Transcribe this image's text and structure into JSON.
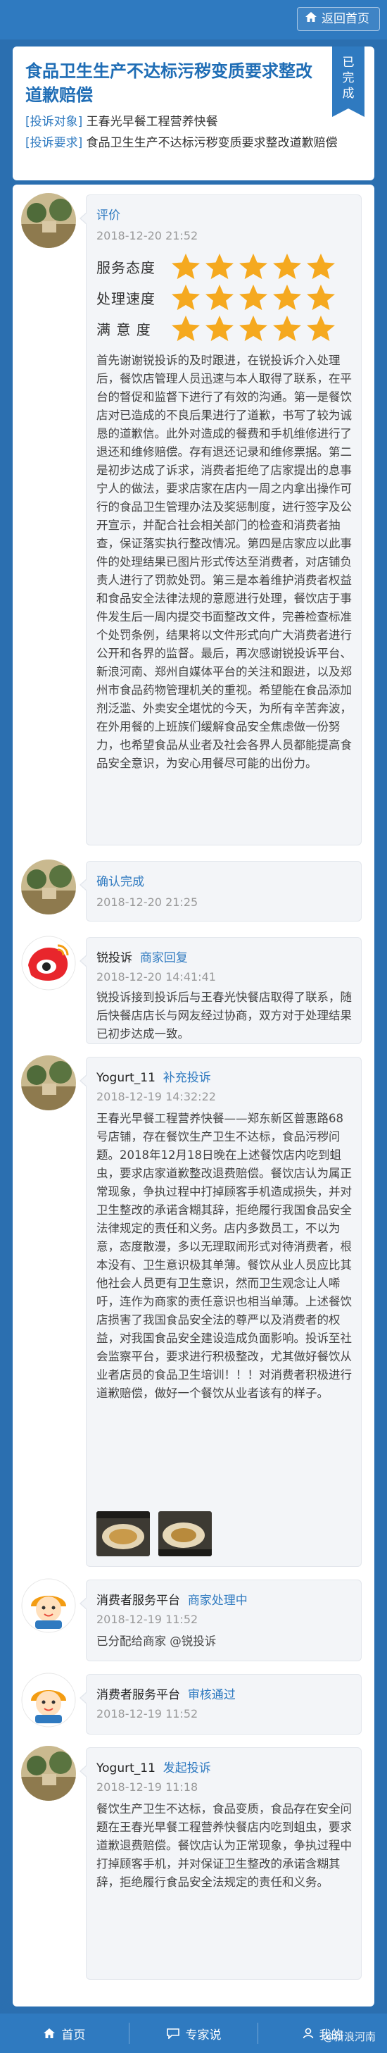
{
  "header": {
    "back_label": "返回首页"
  },
  "complaint": {
    "title": "食品卫生生产不达标污秽变质要求整改道歉赔偿",
    "status": "已完成",
    "target_tag": "[投诉对象]",
    "target_value": "王春光早餐工程营养快餐",
    "demand_tag": "[投诉要求]",
    "demand_value": "食品卫生生产不达标污秽变质要求整改道歉赔偿"
  },
  "thread": [
    {
      "kind": "review",
      "head": "评价",
      "time": "2018-12-20 21:52",
      "ratings": [
        {
          "label": "服务态度",
          "stars": 5
        },
        {
          "label": "处理速度",
          "stars": 5
        },
        {
          "label": "满 意 度",
          "stars": 5
        }
      ],
      "text": "首先谢谢锐投诉的及时跟进，在锐投诉介入处理后，餐饮店管理人员迅速与本人取得了联系，在平台的督促和监督下进行了有效的沟通。第一是餐饮店对已造成的不良后果进行了道歉，书写了较为诚恳的道歉信。此外对造成的餐费和手机维修进行了退还和维修赔偿。存有退还记录和维修票据。第二是初步达成了诉求，消费者拒绝了店家提出的息事宁人的做法，要求店家在店内一周之内拿出操作可行的食品卫生管理办法及奖惩制度，进行签字及公开宣示，并配合社会相关部门的检查和消费者抽查，保证落实执行整改情况。第四是店家应以此事件的处理结果已图片形式传达至消费者，对店铺负责人进行了罚款处罚。第三是本着维护消费者权益和食品安全法律法规的意愿进行处理，餐饮店于事件发生后一周内提交书面整改文件，完善检查标准个处罚条例，结果将以文件形式向广大消费者进行公开和各界的监督。最后，再次感谢锐投诉平台、新浪河南、郑州自媒体平台的关注和跟进，以及郑州市食品药物管理机关的重视。希望能在食品添加剂泛滥、外卖安全堪忧的今天，为所有辛苦奔波，在外用餐的上班族们缓解食品安全焦虑做一份努力，也希望食品从业者及社会各界人员都能提高食品安全意识，为安心用餐尽可能的出份力。"
    },
    {
      "kind": "confirm",
      "head": "确认完成",
      "time": "2018-12-20 21:25"
    },
    {
      "kind": "merchant",
      "name": "锐投诉",
      "head": "商家回复",
      "time": "2018-12-20 14:41:41",
      "text": "锐投诉接到投诉后与王春光快餐店取得了联系，随后快餐店店长与网友经过协商，双方对于处理结果已初步达成一致。"
    },
    {
      "kind": "supplement",
      "name": "Yogurt_11",
      "head": "补充投诉",
      "time": "2018-12-19 14:32:22",
      "text": "王春光早餐工程营养快餐——郑东新区普惠路68号店铺，存在餐饮生产卫生不达标，食品污秽问题。2018年12月18日晚在上述餐饮店内吃到蛆虫，要求店家道歉整改退费赔偿。餐饮店认为属正常现象，争执过程中打掉顾客手机造成损失，并对卫生整改的承诺含糊其辞，拒绝履行我国食品安全法律规定的责任和义务。店内多数员工，不以为意，态度散漫，多以无理取闹形式对待消费者，根本没有、卫生意识极其单薄。餐饮从业人员应比其他社会人员更有卫生意识，然而卫生观念让人唏吁，连作为商家的责任意识也相当单薄。上述餐饮店损害了我国食品安全法的尊严以及消费者的权益，对我国食品安全建设造成负面影响。投诉至社会监察平台，要求进行积极整改，尤其做好餐饮从业者店员的食品卫生培训！！！对消费者积极进行道歉赔偿，做好一个餐饮从业者该有的样子。"
    },
    {
      "kind": "platform",
      "name": "消费者服务平台",
      "head": "商家处理中",
      "time": "2018-12-19 11:52",
      "text": "已分配给商家 @锐投诉"
    },
    {
      "kind": "platform",
      "name": "消费者服务平台",
      "head": "审核通过",
      "time": "2018-12-19 11:52"
    },
    {
      "kind": "initial",
      "name": "Yogurt_11",
      "head": "发起投诉",
      "time": "2018-12-19 11:18",
      "text": "餐饮生产卫生不达标，食品变质，食品存在安全问题在王春光早餐工程营养快餐店内吃到蛆虫，要求道歉退费赔偿。餐饮店认为正常现象，争执过程中打掉顾客手机，并对保证卫生整改的承诺含糊其辞，拒绝履行食品安全法规定的责任和义务。"
    }
  ],
  "bottom_nav": {
    "home": "首页",
    "expert": "专家说",
    "mine": "我的"
  },
  "watermark": "@新浪河南",
  "colors": {
    "brand_blue": "#2f7ac0",
    "star": "#f5a91f"
  }
}
